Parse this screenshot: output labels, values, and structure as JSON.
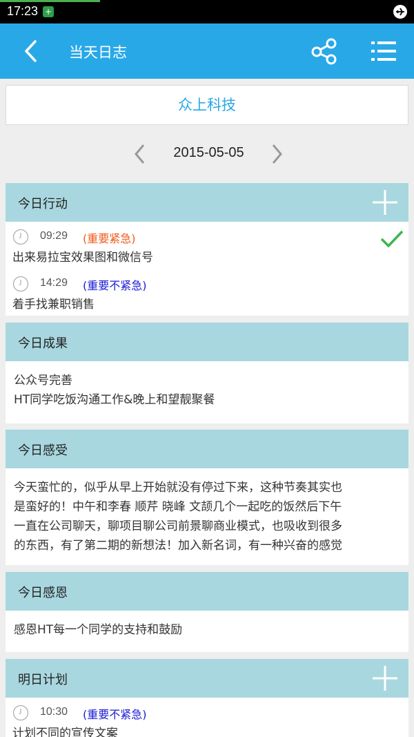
{
  "status_bar": {
    "time": "17:23"
  },
  "app_bar": {
    "title": "当天日志"
  },
  "company": {
    "name": "众上科技"
  },
  "date": "2015-05-05",
  "sections": {
    "actions": {
      "title": "今日行动",
      "tasks": [
        {
          "time": "09:29",
          "priority": "(重要紧急)",
          "priority_color": "#f05a1a",
          "desc": "出来易拉宝效果图和微信号",
          "done": true
        },
        {
          "time": "14:29",
          "priority": "(重要不紧急)",
          "priority_color": "#1a1ad6",
          "desc": "着手找兼职销售",
          "done": false
        }
      ]
    },
    "results": {
      "title": "今日成果",
      "lines": [
        "公众号完善",
        "HT同学吃饭沟通工作&晚上和望靓聚餐"
      ]
    },
    "feelings": {
      "title": "今日感受",
      "lines": [
        "今天蛮忙的，似乎从早上开始就没有停过下来，这种节奏其实也",
        "是蛮好的！中午和李春 顺芹 晓峰 文颉几个一起吃的饭然后下午",
        "一直在公司聊天，聊项目聊公司前景聊商业模式，也吸收到很多",
        "的东西，有了第二期的新想法！加入新名词，有一种兴奋的感觉"
      ]
    },
    "gratitude": {
      "title": "今日感恩",
      "lines": [
        "感恩HT每一个同学的支持和鼓励"
      ]
    },
    "plan": {
      "title": "明日计划",
      "tasks": [
        {
          "time": "10:30",
          "priority": "(重要不紧急)",
          "priority_color": "#1a1ad6",
          "desc": "计划不同的宣传文案"
        }
      ]
    }
  },
  "colors": {
    "accent": "#29a8e8",
    "section_header": "#a8d7df",
    "check": "#3bb54a"
  },
  "icons": [
    "back-icon",
    "share-icon",
    "menu-icon",
    "add-icon",
    "clock-icon",
    "check-icon",
    "chevron-left-icon",
    "chevron-right-icon",
    "airplane-mode-icon"
  ]
}
